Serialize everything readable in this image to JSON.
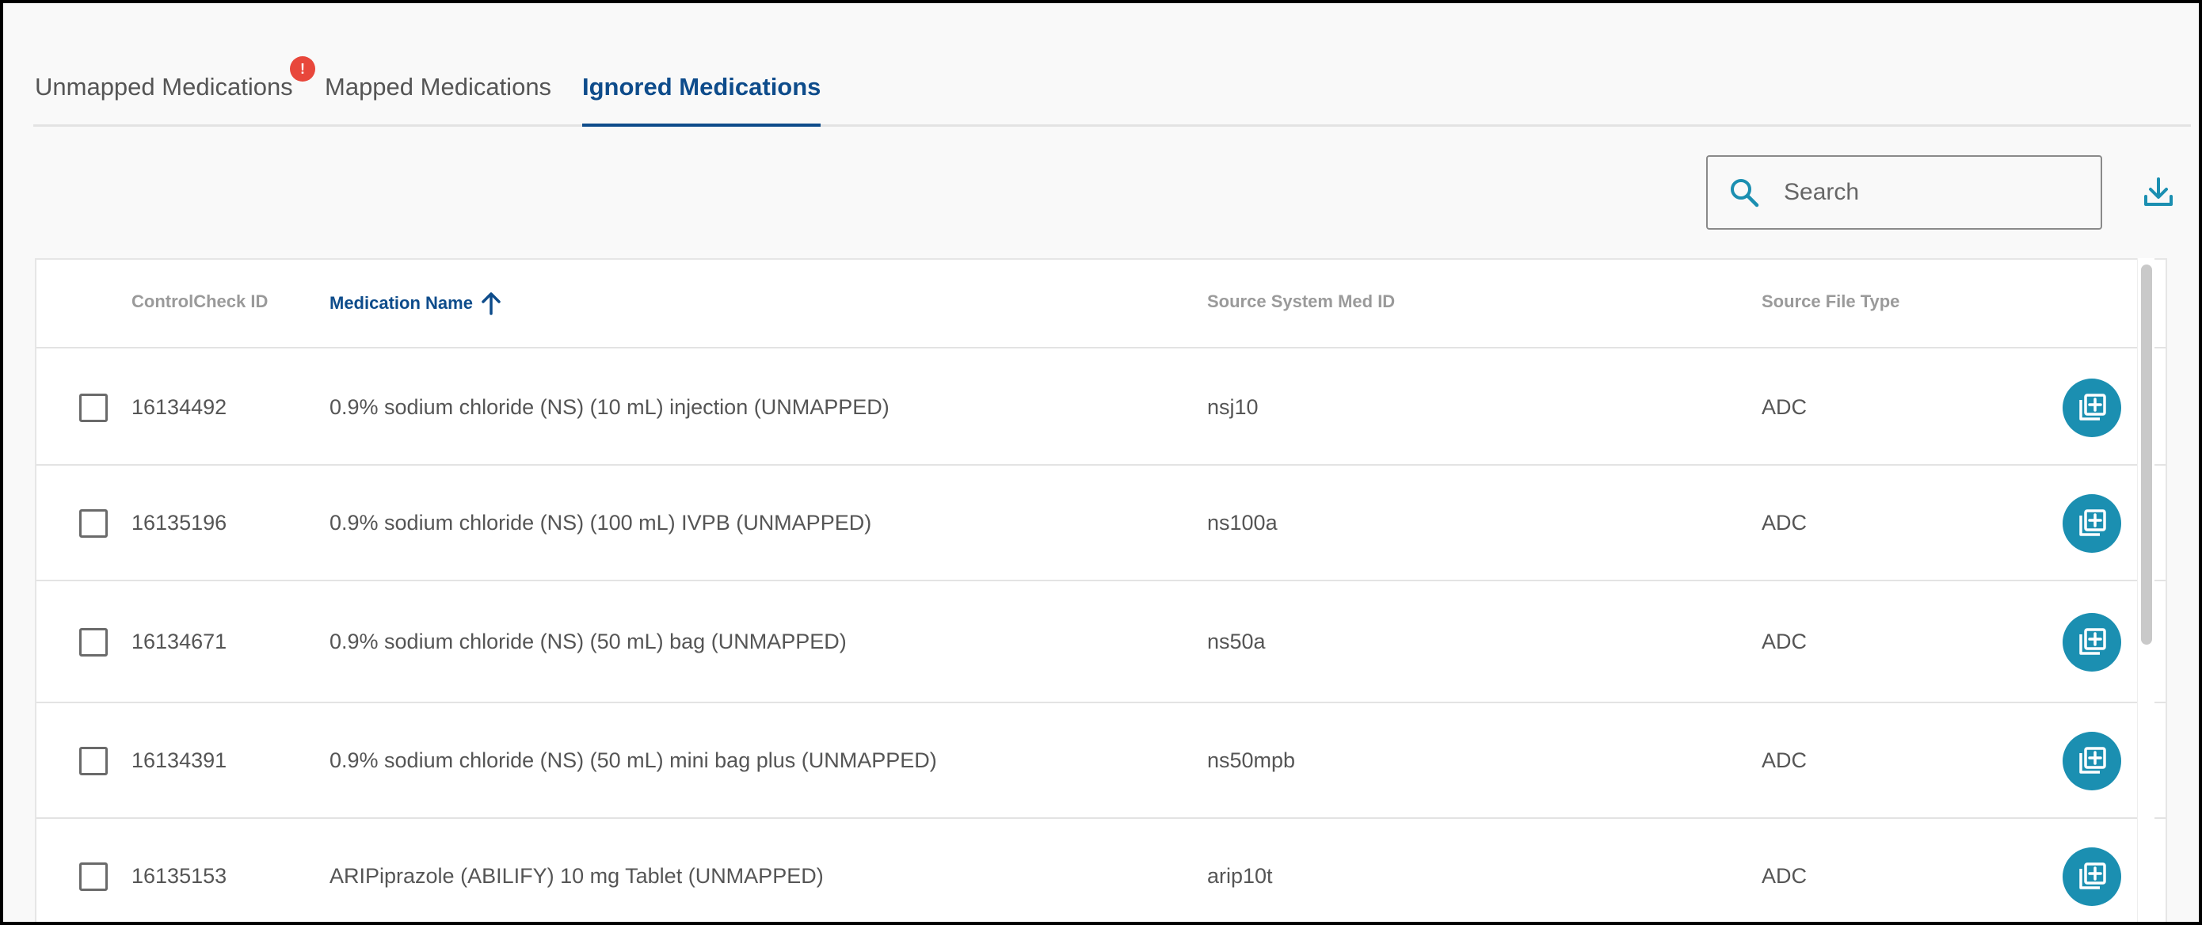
{
  "tabs": [
    {
      "label": "Unmapped Medications",
      "badge": "!"
    },
    {
      "label": "Mapped Medications"
    },
    {
      "label": "Ignored Medications",
      "active": true
    }
  ],
  "search": {
    "placeholder": "Search",
    "icon": "search-icon"
  },
  "toolbar": {
    "download_icon": "download-icon"
  },
  "table": {
    "columns": [
      {
        "label": ""
      },
      {
        "label": "ControlCheck ID"
      },
      {
        "label": "Medication Name",
        "sorted": "ascending"
      },
      {
        "label": "Source System Med ID"
      },
      {
        "label": "Source File Type"
      }
    ],
    "rows": [
      {
        "id": "16134492",
        "name": "0.9% sodium chloride (NS) (10 mL) injection (UNMAPPED)",
        "source_id": "nsj10",
        "file_type": "ADC"
      },
      {
        "id": "16135196",
        "name": "0.9% sodium chloride (NS) (100 mL) IVPB (UNMAPPED)",
        "source_id": "ns100a",
        "file_type": "ADC"
      },
      {
        "id": "16134671",
        "name": "0.9% sodium chloride (NS) (50 mL) bag (UNMAPPED)",
        "source_id": "ns50a",
        "file_type": "ADC"
      },
      {
        "id": "16134391",
        "name": "0.9% sodium chloride (NS) (50 mL) mini bag plus (UNMAPPED)",
        "source_id": "ns50mpb",
        "file_type": "ADC"
      },
      {
        "id": "16135153",
        "name": "ARIPiprazole (ABILIFY) 10 mg Tablet (UNMAPPED)",
        "source_id": "arip10t",
        "file_type": "ADC"
      }
    ],
    "row_action_icon": "add-to-list-icon"
  },
  "colors": {
    "accent": "#0e4c8b",
    "action": "#1b8fb1",
    "badge": "#e8473b"
  }
}
